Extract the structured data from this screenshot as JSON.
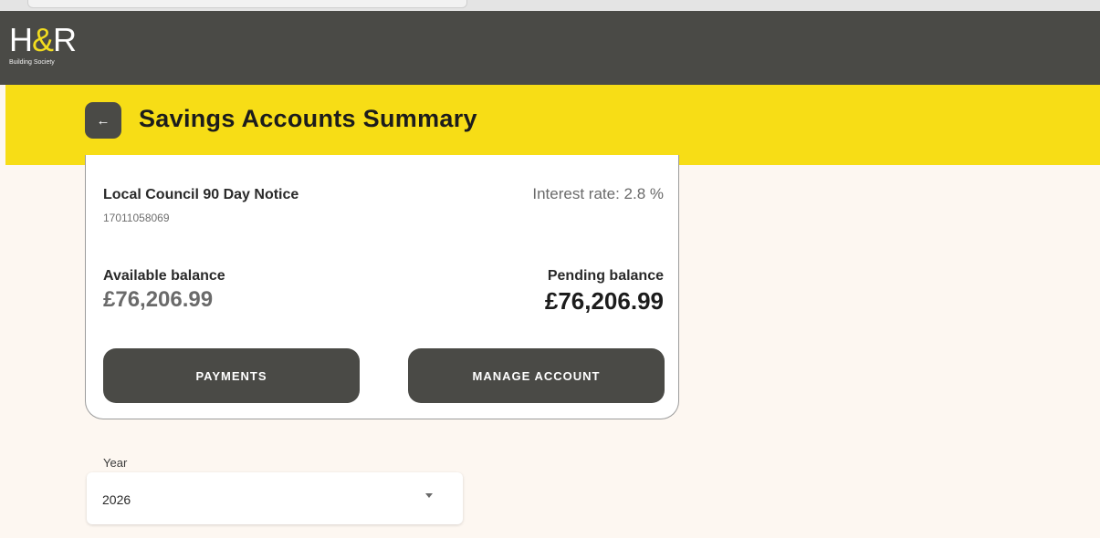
{
  "header": {
    "logo_text_left": "H",
    "logo_text_amp": "&",
    "logo_text_right": "R",
    "logo_subtitle": "Building Society"
  },
  "titlebar": {
    "back_icon": "←",
    "title": "Savings Accounts Summary"
  },
  "account": {
    "name": "Local Council 90 Day Notice",
    "number": "17011058069",
    "interest_rate": "Interest rate: 2.8 %",
    "available_label": "Available balance",
    "available_value": "£76,206.99",
    "pending_label": "Pending balance",
    "pending_value": "£76,206.99",
    "payments_button": "PAYMENTS",
    "manage_button": "MANAGE ACCOUNT"
  },
  "year_filter": {
    "label": "Year",
    "selected": "2026"
  },
  "colors": {
    "brand_dark": "#4a4a46",
    "brand_yellow": "#f7dd16"
  }
}
